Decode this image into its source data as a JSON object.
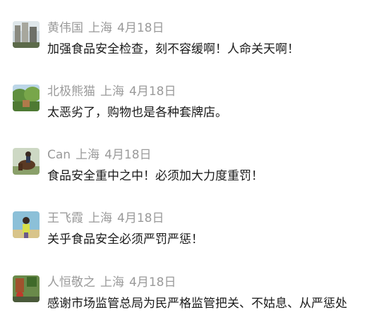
{
  "comments": [
    {
      "username": "黄伟国",
      "location": "上海",
      "date": "4月18日",
      "text": "加强食品安全检查，刻不容缓啊！人命关天啊！",
      "avatar_icon": "buildings-photo-avatar"
    },
    {
      "username": "北极熊猫",
      "location": "上海",
      "date": "4月18日",
      "text": "太恶劣了，购物也是各种套牌店。",
      "avatar_icon": "trees-photo-avatar"
    },
    {
      "username": "Can",
      "location": "上海",
      "date": "4月18日",
      "text": "食品安全重中之中！必须加大力度重罚！",
      "avatar_icon": "horse-rider-photo-avatar"
    },
    {
      "username": "王飞霞",
      "location": "上海",
      "date": "4月18日",
      "text": "关乎食品安全必须严罚严惩！",
      "avatar_icon": "person-portrait-avatar"
    },
    {
      "username": "人恒敬之",
      "location": "上海",
      "date": "4月18日",
      "text": "感谢市场监管总局为民严格监管把关、不姑息、从严惩处",
      "avatar_icon": "garden-photo-avatar"
    }
  ],
  "colors": {
    "meta": "#9a9a9a",
    "text": "#1a1a1a"
  }
}
